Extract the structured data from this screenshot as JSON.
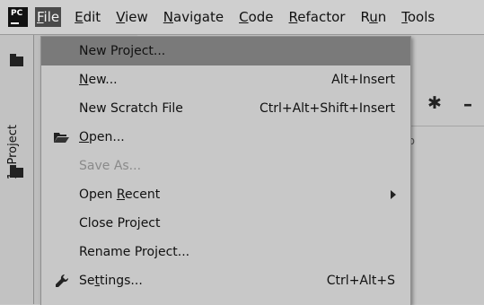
{
  "app": {
    "logo_text": "PC"
  },
  "menubar": {
    "items": [
      {
        "name": "menu-file",
        "label": "File",
        "underline": "F",
        "rest": "ile",
        "active": true
      },
      {
        "name": "menu-edit",
        "label": "Edit",
        "underline": "E",
        "rest": "dit"
      },
      {
        "name": "menu-view",
        "label": "View",
        "underline": "V",
        "rest": "iew"
      },
      {
        "name": "menu-navigate",
        "label": "Navigate",
        "underline": "N",
        "rest": "avigate"
      },
      {
        "name": "menu-code",
        "label": "Code",
        "underline": "C",
        "rest": "ode"
      },
      {
        "name": "menu-refactor",
        "label": "Refactor",
        "underline": "R",
        "rest": "efactor"
      },
      {
        "name": "menu-run",
        "label": "Run",
        "pre": "R",
        "underline": "u",
        "rest": "n"
      },
      {
        "name": "menu-tools",
        "label": "Tools",
        "underline": "T",
        "rest": "ools"
      }
    ]
  },
  "left_strip": {
    "project_tab": "1: Project"
  },
  "background": {
    "partial_text": "llo"
  },
  "file_menu": {
    "items": [
      {
        "label": "New Project...",
        "shortcut": ""
      },
      {
        "label": "New...",
        "shortcut": "Alt+Insert"
      },
      {
        "label": "New Scratch File",
        "shortcut": "Ctrl+Alt+Shift+Insert"
      },
      {
        "label": "Open...",
        "shortcut": ""
      },
      {
        "label": "Save As...",
        "shortcut": ""
      },
      {
        "label": "Open Recent",
        "shortcut": ""
      },
      {
        "label": "Close Project",
        "shortcut": ""
      },
      {
        "label": "Rename Project...",
        "shortcut": ""
      },
      {
        "label": "Settings...",
        "shortcut": "Ctrl+Alt+S"
      }
    ]
  },
  "colors": {
    "highlight": "#7a7a7a",
    "menubar": "#cfcfcf",
    "disabled_text": "#8a8a8a"
  }
}
